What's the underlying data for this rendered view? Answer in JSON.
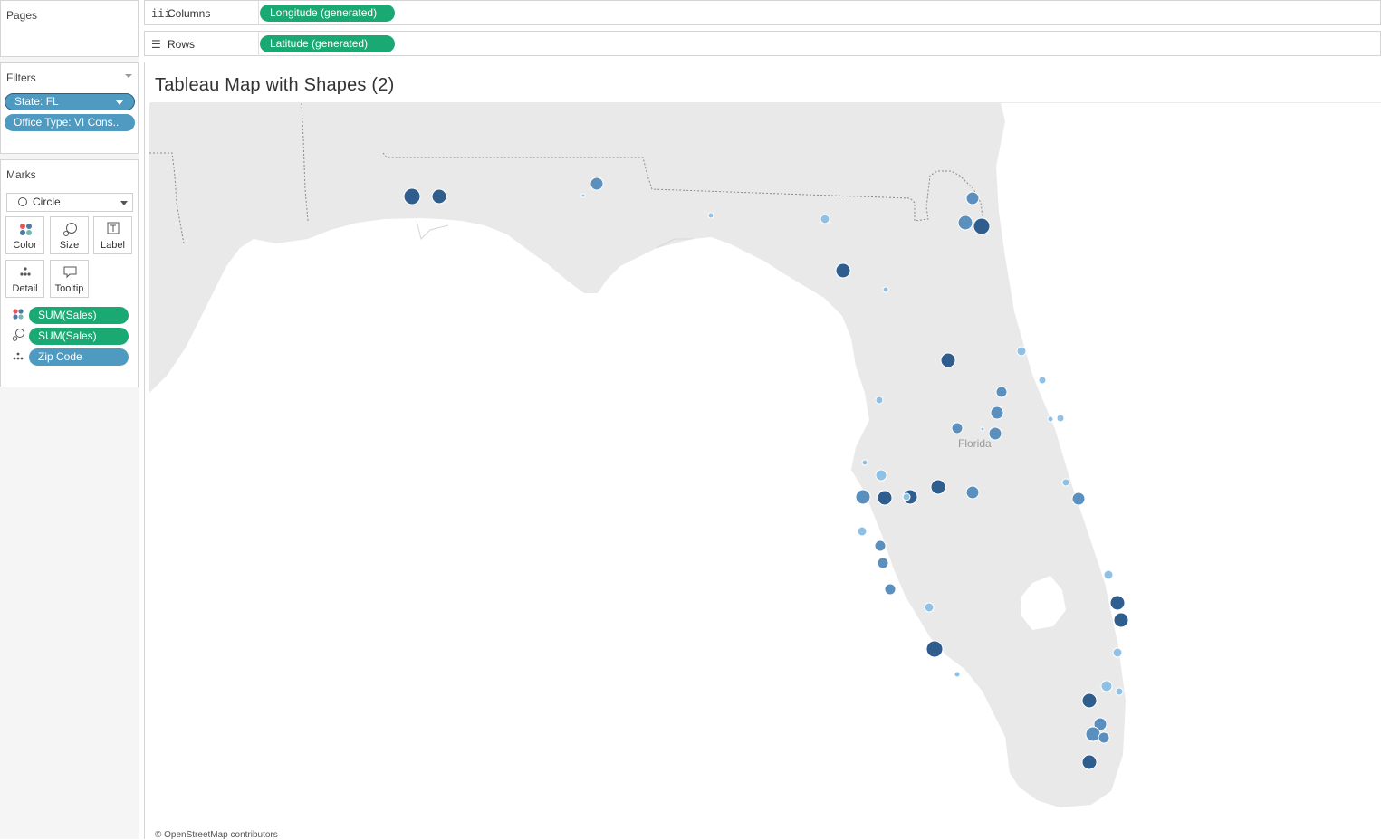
{
  "shelves": {
    "pages_label": "Pages",
    "columns": {
      "label": "Columns",
      "pill": "Longitude (generated)"
    },
    "rows": {
      "label": "Rows",
      "pill": "Latitude (generated)"
    }
  },
  "filters": {
    "label": "Filters",
    "items": [
      "State: FL",
      "Office Type: VI Cons.."
    ]
  },
  "marks": {
    "label": "Marks",
    "mark_type": "Circle",
    "buttons": [
      "Color",
      "Size",
      "Label",
      "Detail",
      "Tooltip"
    ],
    "encodings": [
      {
        "icon": "color-encoding-icon",
        "field": "SUM(Sales)"
      },
      {
        "icon": "size-encoding-icon",
        "field": "SUM(Sales)"
      },
      {
        "icon": "detail-encoding-icon",
        "field": "Zip Code"
      }
    ]
  },
  "view": {
    "title": "Tableau Map with Shapes (2)",
    "map_label": "Florida",
    "attribution": "© OpenStreetMap contributors"
  },
  "colors": {
    "measure_pill": "#1aa873",
    "dimension_pill": "#4f9ac1",
    "land": "#e9e9e9",
    "water": "#ffffff",
    "mark_dark": "#2e5d8e",
    "mark_light": "#8fc0e6"
  }
}
